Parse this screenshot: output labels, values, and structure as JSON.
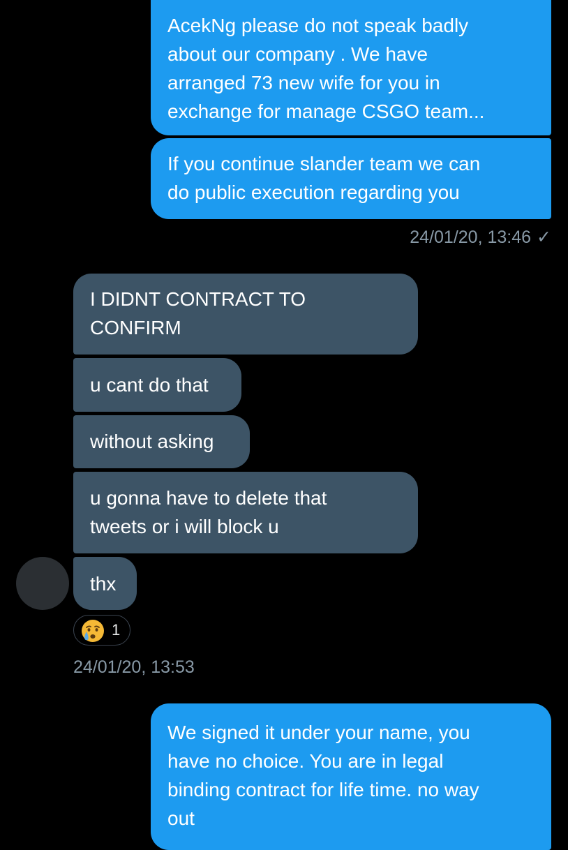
{
  "conversation": {
    "messages_sent_1": [
      "AcekNg please do not speak badly\nabout our company . We have\narranged 73 new wife for you in\nexchange for manage CSGO team...",
      "If you continue slander team we can\ndo public execution regarding you"
    ],
    "timestamp_1": "24/01/20, 13:46",
    "read_indicator": "✓",
    "messages_received": [
      "I DIDNT CONTRACT TO\nCONFIRM",
      "u cant do that",
      "without asking",
      "u gonna have to delete that\ntweets or i will block u",
      "thx"
    ],
    "reaction": {
      "emoji": "crying-face",
      "count": "1"
    },
    "timestamp_2": "24/01/20, 13:53",
    "messages_sent_2": [
      "We signed it under your name, you\nhave no choice. You are in legal\nbinding contract for life time. no way\nout"
    ]
  },
  "colors": {
    "background": "#000000",
    "sent_bubble": "#1d9bf0",
    "received_bubble": "#3d5466",
    "meta_text": "#8899a6"
  }
}
